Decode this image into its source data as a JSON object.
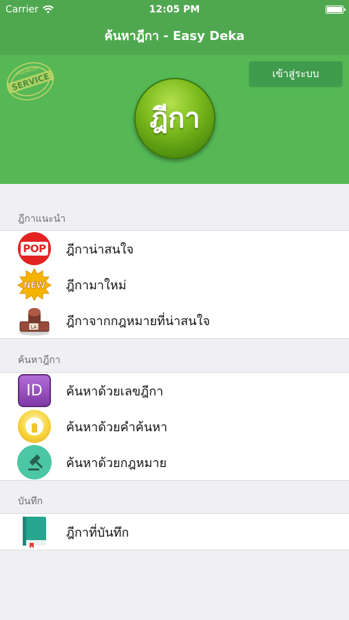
{
  "status": {
    "carrier": "Carrier",
    "time": "12:05 PM"
  },
  "nav": {
    "title": "ค้นหาฎีกา - Easy Deka"
  },
  "hero": {
    "login_label": "เข้าสู่ระบบ",
    "logo_text": "ฎีกา",
    "stamp_top": "PREMIUM",
    "stamp_main": "SERVICE"
  },
  "sections": [
    {
      "header": "ฎีกาแนะนำ",
      "items": [
        {
          "label": "ฎีกาน่าสนใจ",
          "icon": "pop-icon",
          "icon_text": "POP"
        },
        {
          "label": "ฎีกามาใหม่",
          "icon": "new-badge-icon",
          "icon_text": "NEW"
        },
        {
          "label": "ฎีกาจากกฎหมายที่น่าสนใจ",
          "icon": "law-stamp-icon",
          "icon_text": "LA"
        }
      ]
    },
    {
      "header": "ค้นหาฎีกา",
      "items": [
        {
          "label": "ค้นหาด้วยเลขฎีกา",
          "icon": "id-icon",
          "icon_text": "ID"
        },
        {
          "label": "ค้นหาด้วยคำค้นหา",
          "icon": "keyhole-icon"
        },
        {
          "label": "ค้นหาด้วยกฎหมาย",
          "icon": "gavel-icon"
        }
      ]
    },
    {
      "header": "บันทึก",
      "items": [
        {
          "label": "ฎีกาที่บันทึก",
          "icon": "book-icon"
        }
      ]
    }
  ],
  "colors": {
    "brand_green": "#4fa84f",
    "hero_green": "#55b855",
    "button_green": "#3f9c4c"
  }
}
